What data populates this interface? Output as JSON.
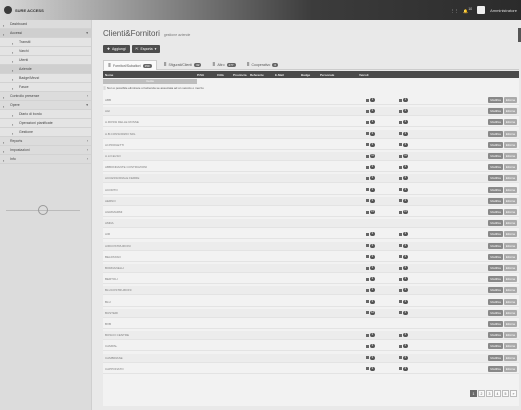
{
  "app": {
    "brand": "SURE ACCESS",
    "user_label": "Amministratore",
    "notif_count": "10"
  },
  "sidebar": {
    "items": [
      {
        "label": "Dashboard",
        "icon": "dashboard-icon",
        "level": 0,
        "active": false
      },
      {
        "label": "Accessi",
        "icon": "users-icon",
        "level": 0,
        "active": true,
        "arrow": "▾"
      },
      {
        "label": "Transiti",
        "icon": "filter-icon",
        "level": 1,
        "active": false
      },
      {
        "label": "Varchi",
        "icon": "grid-icon",
        "level": 1,
        "active": false
      },
      {
        "label": "Utenti",
        "icon": "user-icon",
        "level": 1,
        "active": false
      },
      {
        "label": "Aziende",
        "icon": "building-icon",
        "level": 1,
        "active": true
      },
      {
        "label": "Badge/Mezzi",
        "icon": "badge-icon",
        "level": 1,
        "active": false
      },
      {
        "label": "Fasce",
        "icon": "clock-icon",
        "level": 1,
        "active": false
      },
      {
        "label": "Controllo presenze",
        "icon": "check-icon",
        "level": 0,
        "active": false,
        "arrow": "‹"
      },
      {
        "label": "Opere",
        "icon": "wrench-icon",
        "level": 0,
        "active": false,
        "arrow": "▾"
      },
      {
        "label": "Diario di bordo",
        "icon": "book-icon",
        "level": 1,
        "active": false
      },
      {
        "label": "Operazioni pianificate",
        "icon": "calendar-icon",
        "level": 1,
        "active": false
      },
      {
        "label": "Gestione",
        "icon": "gear-icon",
        "level": 1,
        "active": false
      },
      {
        "label": "Reports",
        "icon": "chart-icon",
        "level": 0,
        "active": false,
        "arrow": "‹"
      },
      {
        "label": "Impostazioni",
        "icon": "settings-icon",
        "level": 0,
        "active": false,
        "arrow": "‹"
      },
      {
        "label": "Info",
        "icon": "info-icon",
        "level": 0,
        "active": false,
        "arrow": "‹"
      }
    ]
  },
  "page": {
    "title": "Clienti&Fornitori",
    "subtitle": "gestione aziende"
  },
  "toolbar": {
    "add_label": "Aggiungi",
    "export_label": "Esporta"
  },
  "tabs": [
    {
      "label": "Fornitori/Subaltori",
      "count": "150",
      "active": true
    },
    {
      "label": "Sfigurati/Clienti",
      "count": "32",
      "active": false
    },
    {
      "label": "Altro",
      "count": "277",
      "active": false
    },
    {
      "label": "Cooperativo",
      "count": "0",
      "active": false
    }
  ],
  "table": {
    "columns": [
      "Nome",
      "P.IVA",
      "Città",
      "Provincia",
      "Referente",
      "E-Mail",
      "Badge",
      "Personale",
      "Veicoli"
    ],
    "filter_placeholder": "Cerca",
    "note": "Non è possibile eliminare un'azienda se associata ad un veicolo o mezzo",
    "action_edit": "Modifica",
    "action_delete": "Elimina",
    "rows": [
      {
        "name": "ABB",
        "persons": "1",
        "vehicles": "1"
      },
      {
        "name": "A&I",
        "persons": "0",
        "vehicles": "0"
      },
      {
        "name": "A.ROSSI DELLE ROSSE",
        "persons": "2",
        "vehicles": "0"
      },
      {
        "name": "A.B.CONSORZIO SRL",
        "persons": "0",
        "vehicles": "0"
      },
      {
        "name": "AI.PROGETTI",
        "persons": "0",
        "vehicles": "0"
      },
      {
        "name": "A.LO.ELSO",
        "persons": "11",
        "vehicles": "11"
      },
      {
        "name": "ABBONDANTE COSTRUZIONI",
        "persons": "0",
        "vehicles": "0"
      },
      {
        "name": "ACCESSORIALE FERRE",
        "persons": "0",
        "vehicles": "0"
      },
      {
        "name": "ACORTO",
        "persons": "0",
        "vehicles": "0"
      },
      {
        "name": "AERNO",
        "persons": "0",
        "vehicles": "0"
      },
      {
        "name": "AGRIMARMI",
        "persons": "15",
        "vehicles": "15"
      },
      {
        "name": "AMDA",
        "persons": "",
        "vehicles": ""
      },
      {
        "name": "AIR",
        "persons": "0",
        "vehicles": "0"
      },
      {
        "name": "AIRCOSTRUZIONI",
        "persons": "0",
        "vehicles": "0"
      },
      {
        "name": "BELPASSO",
        "persons": "0",
        "vehicles": "0"
      },
      {
        "name": "BORDANELLI",
        "persons": "0",
        "vehicles": "0"
      },
      {
        "name": "BERTOLI",
        "persons": "0",
        "vehicles": "0"
      },
      {
        "name": "BLUCOSTRUZIONI",
        "persons": "0",
        "vehicles": "0"
      },
      {
        "name": "BLU",
        "persons": "0",
        "vehicles": "0"
      },
      {
        "name": "BUSTERI",
        "persons": "12",
        "vehicles": "0"
      },
      {
        "name": "BVB",
        "persons": "",
        "vehicles": ""
      },
      {
        "name": "BOSCO CENTRE",
        "persons": "0",
        "vehicles": "0"
      },
      {
        "name": "CAMPAL",
        "persons": "0",
        "vehicles": "0"
      },
      {
        "name": "CAMBRIASE",
        "persons": "0",
        "vehicles": "0"
      },
      {
        "name": "CAPPONATO",
        "persons": "0",
        "vehicles": "0"
      }
    ]
  },
  "pagination": {
    "pages": [
      "1",
      "2",
      "3",
      "4",
      "5",
      "»"
    ],
    "active": "1"
  }
}
